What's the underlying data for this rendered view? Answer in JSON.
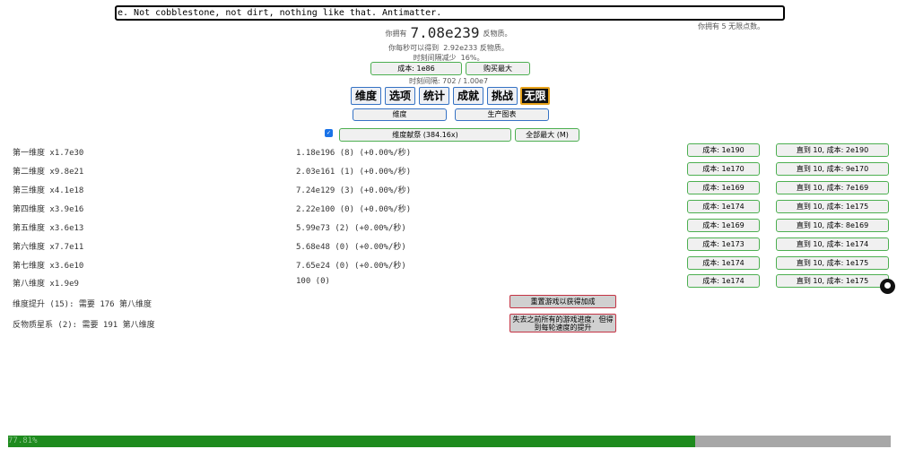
{
  "news": "e. Not cobblestone, not dirt, nothing like that. Antimatter.",
  "infinity_points": "你拥有 5 无限点数。",
  "antimatter": {
    "prefix": "你拥有",
    "amount": "7.08e239",
    "suffix": "反物质。"
  },
  "per_second": {
    "prefix": "你每秒可以得到",
    "amount": "2.92e233",
    "suffix": "反物质。"
  },
  "tick_reduce": {
    "prefix": "时刻间隔减少",
    "amount": "16%。"
  },
  "tickspeed": {
    "cost_label": "成本: 1e86",
    "max_label": "购买最大",
    "interval": "时刻间隔: 702 / 1.00e7"
  },
  "tabs": [
    "维度",
    "选项",
    "统计",
    "成就",
    "挑战",
    "无限"
  ],
  "subtabs": [
    "维度",
    "生产图表"
  ],
  "sacrifice": {
    "checkbox": "✓",
    "label": "维度献祭 (384.16x)",
    "max_all": "全部最大 (M)"
  },
  "dimensions": [
    {
      "name": "第一维度 x1.7e30",
      "amount": "1.18e196 (8) (+0.00%/秒)",
      "cost": "成本: 1e190",
      "until": "直到 10, 成本: 2e190"
    },
    {
      "name": "第二维度 x9.8e21",
      "amount": "2.03e161 (1) (+0.00%/秒)",
      "cost": "成本: 1e170",
      "until": "直到 10, 成本: 9e170"
    },
    {
      "name": "第三维度 x4.1e18",
      "amount": "7.24e129 (3) (+0.00%/秒)",
      "cost": "成本: 1e169",
      "until": "直到 10, 成本: 7e169"
    },
    {
      "name": "第四维度 x3.9e16",
      "amount": "2.22e100 (0) (+0.00%/秒)",
      "cost": "成本: 1e174",
      "until": "直到 10, 成本: 1e175"
    },
    {
      "name": "第五维度 x3.6e13",
      "amount": "5.99e73 (2) (+0.00%/秒)",
      "cost": "成本: 1e169",
      "until": "直到 10, 成本: 8e169"
    },
    {
      "name": "第六维度 x7.7e11",
      "amount": "5.68e48 (0) (+0.00%/秒)",
      "cost": "成本: 1e173",
      "until": "直到 10, 成本: 1e174"
    },
    {
      "name": "第七维度 x3.6e10",
      "amount": "7.65e24 (0) (+0.00%/秒)",
      "cost": "成本: 1e174",
      "until": "直到 10, 成本: 1e175"
    },
    {
      "name": "第八维度 x1.9e9",
      "amount": "100 (0)",
      "cost": "成本: 1e174",
      "until": "直到 10, 成本: 1e175"
    }
  ],
  "dimension_boost": {
    "text": "维度提升 (15): 需要 176 第八维度",
    "button": "重置游戏以获得加成"
  },
  "galaxy": {
    "text": "反物质星系 (2): 需要 191 第八维度",
    "button": "失去之前所有的游戏进度，但得到每轮速度的提升"
  },
  "progress": {
    "label": "77.81%",
    "value": 77.81
  }
}
